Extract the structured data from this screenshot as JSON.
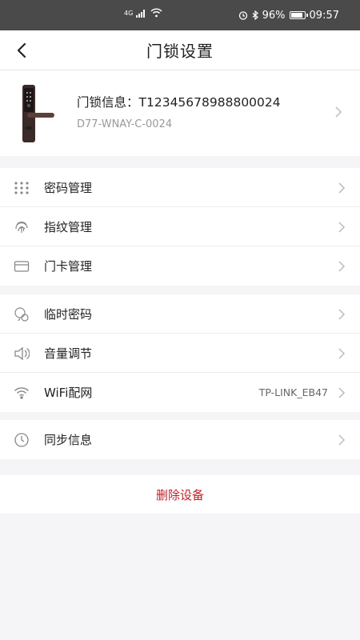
{
  "status_bar": {
    "network": "4G",
    "battery": "96%",
    "battery_level": 0.96,
    "time": "09:57"
  },
  "header": {
    "title": "门锁设置"
  },
  "device": {
    "info_label": "门锁信息：",
    "serial": "T12345678988800024",
    "model": "D77-WNAY-C-0024"
  },
  "group1": [
    {
      "label": "密码管理",
      "icon": "password-grid-icon"
    },
    {
      "label": "指纹管理",
      "icon": "fingerprint-icon"
    },
    {
      "label": "门卡管理",
      "icon": "card-icon"
    }
  ],
  "group2": [
    {
      "label": "临时密码",
      "icon": "chat-key-icon"
    },
    {
      "label": "音量调节",
      "icon": "speaker-icon"
    },
    {
      "label": "WiFi配网",
      "icon": "wifi-icon",
      "value": "TP-LINK_EB47"
    }
  ],
  "group3": [
    {
      "label": "同步信息",
      "icon": "clock-icon"
    }
  ],
  "actions": {
    "delete": "删除设备"
  },
  "colors": {
    "danger": "#c3202a",
    "status_bar": "#4a4a4a",
    "background": "#f5f5f7"
  }
}
